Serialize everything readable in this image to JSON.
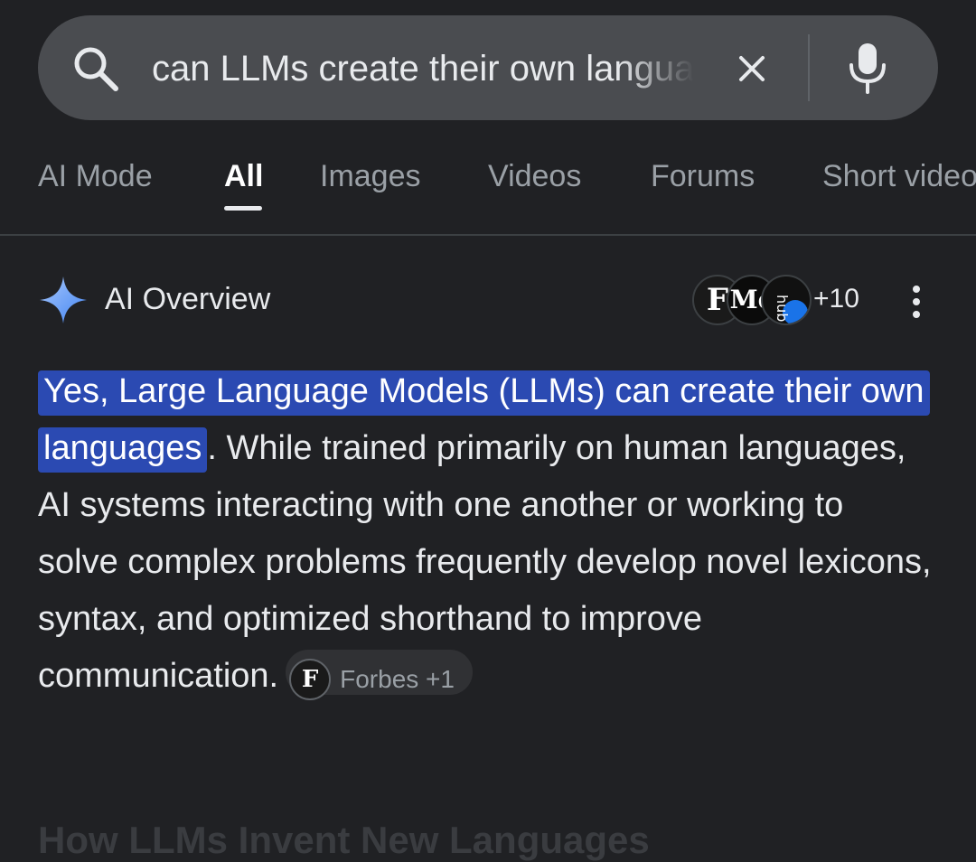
{
  "search": {
    "query": "can LLMs create their own languages",
    "icon": "search-icon",
    "clear_icon": "close-icon",
    "voice_icon": "mic-icon"
  },
  "tabs": [
    {
      "label": "AI Mode",
      "active": false
    },
    {
      "label": "All",
      "active": true
    },
    {
      "label": "Images",
      "active": false
    },
    {
      "label": "Videos",
      "active": false
    },
    {
      "label": "Forums",
      "active": false
    },
    {
      "label": "Short videos",
      "active": false
    }
  ],
  "ai_overview": {
    "title": "AI Overview",
    "sources": {
      "avatars": [
        {
          "letter": "F",
          "name": "Forbes"
        },
        {
          "letter": "Me",
          "name": "Medium"
        },
        {
          "letter": "hub",
          "name": "source-3"
        }
      ],
      "more_count": "+10"
    },
    "highlighted_text": "Yes, Large Language Models (LLMs) can create their own languages",
    "body_text": ". While trained primarily on human languages, AI systems interacting with one another or working to solve complex problems frequently develop novel lexicons, syntax, and optimized shorthand to improve communication.",
    "citation": {
      "letter": "F",
      "label": "Forbes +1"
    }
  },
  "next_heading": "How LLMs Invent New Languages",
  "colors": {
    "background": "#202124",
    "searchbar": "#4a4c50",
    "highlight": "#2b4ab2",
    "sparkle": "#8ab4f8"
  }
}
